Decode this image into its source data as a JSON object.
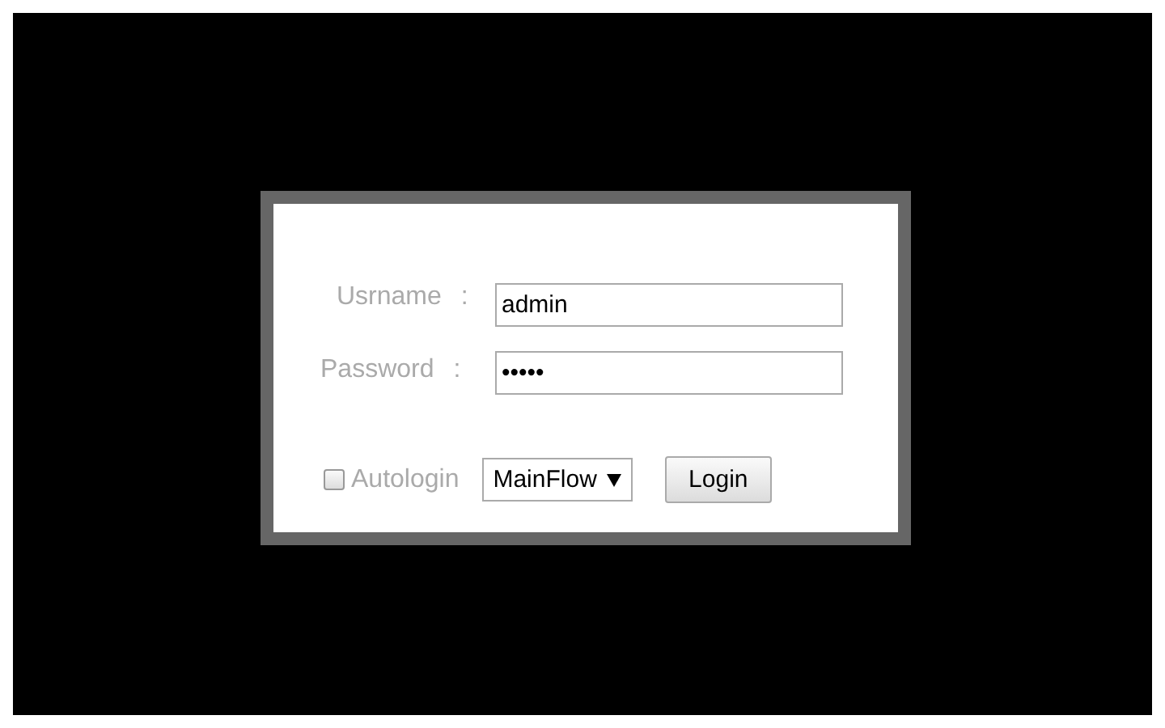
{
  "login": {
    "fields": [
      {
        "label": "Usrname",
        "separator": ":",
        "value": "admin"
      },
      {
        "label": "Password",
        "separator": ":",
        "value": "•••••"
      }
    ],
    "autologin": {
      "label": "Autologin",
      "checked": false
    },
    "flow_select": {
      "value": "MainFlow"
    },
    "button": "Login"
  }
}
